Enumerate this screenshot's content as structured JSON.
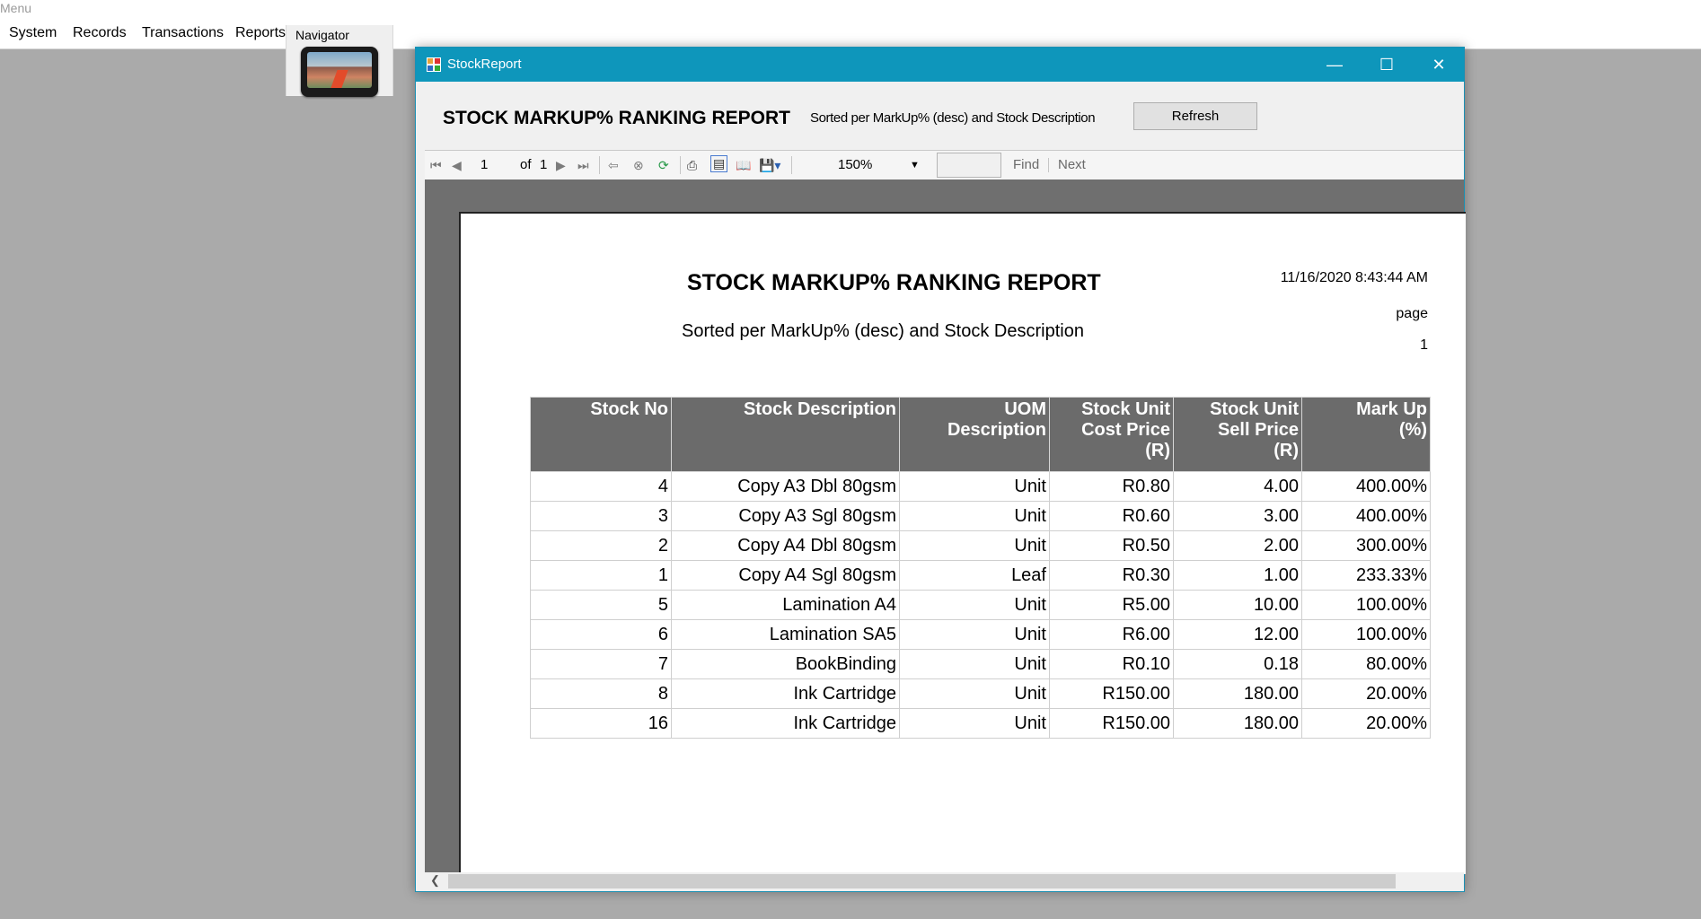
{
  "app": {
    "title": "Menu"
  },
  "menu": [
    "System",
    "Records",
    "Transactions",
    "Reports"
  ],
  "navigator": {
    "label": "Navigator"
  },
  "window": {
    "title": "StockReport"
  },
  "report_header": {
    "title": "STOCK MARKUP% RANKING REPORT",
    "subtitle": "Sorted per MarkUp% (desc) and Stock Description",
    "refresh_label": "Refresh"
  },
  "toolbar": {
    "page": "1",
    "of_label": "of",
    "total_pages": "1",
    "zoom": "150%",
    "find_label": "Find",
    "next_label": "Next"
  },
  "page": {
    "title": "STOCK MARKUP% RANKING REPORT",
    "subtitle": "Sorted per MarkUp% (desc) and Stock Description",
    "datetime": "11/16/2020 8:43:44 AM",
    "page_label": "page",
    "page_number": "1"
  },
  "table": {
    "headers": [
      [
        "Stock No"
      ],
      [
        "Stock Description"
      ],
      [
        "UOM",
        "Description"
      ],
      [
        "Stock Unit",
        "Cost Price",
        "(R)"
      ],
      [
        "Stock Unit",
        "Sell Price",
        "(R)"
      ],
      [
        "Mark Up",
        "(%)"
      ]
    ],
    "rows": [
      [
        "4",
        "Copy A3 Dbl 80gsm",
        "Unit",
        "R0.80",
        "4.00",
        "400.00%"
      ],
      [
        "3",
        "Copy A3 Sgl 80gsm",
        "Unit",
        "R0.60",
        "3.00",
        "400.00%"
      ],
      [
        "2",
        "Copy A4 Dbl 80gsm",
        "Unit",
        "R0.50",
        "2.00",
        "300.00%"
      ],
      [
        "1",
        "Copy A4 Sgl 80gsm",
        "Leaf",
        "R0.30",
        "1.00",
        "233.33%"
      ],
      [
        "5",
        "Lamination A4",
        "Unit",
        "R5.00",
        "10.00",
        "100.00%"
      ],
      [
        "6",
        "Lamination SA5",
        "Unit",
        "R6.00",
        "12.00",
        "100.00%"
      ],
      [
        "7",
        "BookBinding",
        "Unit",
        "R0.10",
        "0.18",
        "80.00%"
      ],
      [
        "8",
        "Ink Cartridge",
        "Unit",
        "R150.00",
        "180.00",
        "20.00%"
      ],
      [
        "16",
        "Ink Cartridge",
        "Unit",
        "R150.00",
        "180.00",
        "20.00%"
      ]
    ]
  }
}
